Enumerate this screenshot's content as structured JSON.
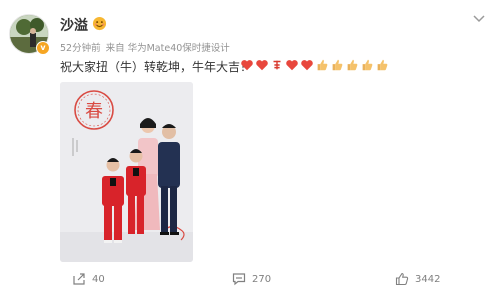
{
  "post": {
    "username": "沙溢",
    "meta": {
      "time": "52分钟前",
      "source": "来自 华为Mate40保时捷设计"
    },
    "text": "祝大家扭（牛）转乾坤，牛年大吉！",
    "emojis": [
      "heart-icon",
      "heart-icon",
      "fu-icon",
      "heart-icon",
      "heart-icon",
      "thumbs-up-icon",
      "thumbs-up-icon",
      "thumbs-up-icon",
      "thumbs-up-icon",
      "thumbs-up-icon"
    ],
    "photo": {
      "seal_char": "春"
    },
    "actions": {
      "share_count": "40",
      "comment_count": "270",
      "like_count": "3442"
    }
  },
  "colors": {
    "username": "#333333",
    "meta": "#939393",
    "heart": "#e8473d",
    "thumb": "#f5c26b",
    "badge": "#f6a623"
  }
}
